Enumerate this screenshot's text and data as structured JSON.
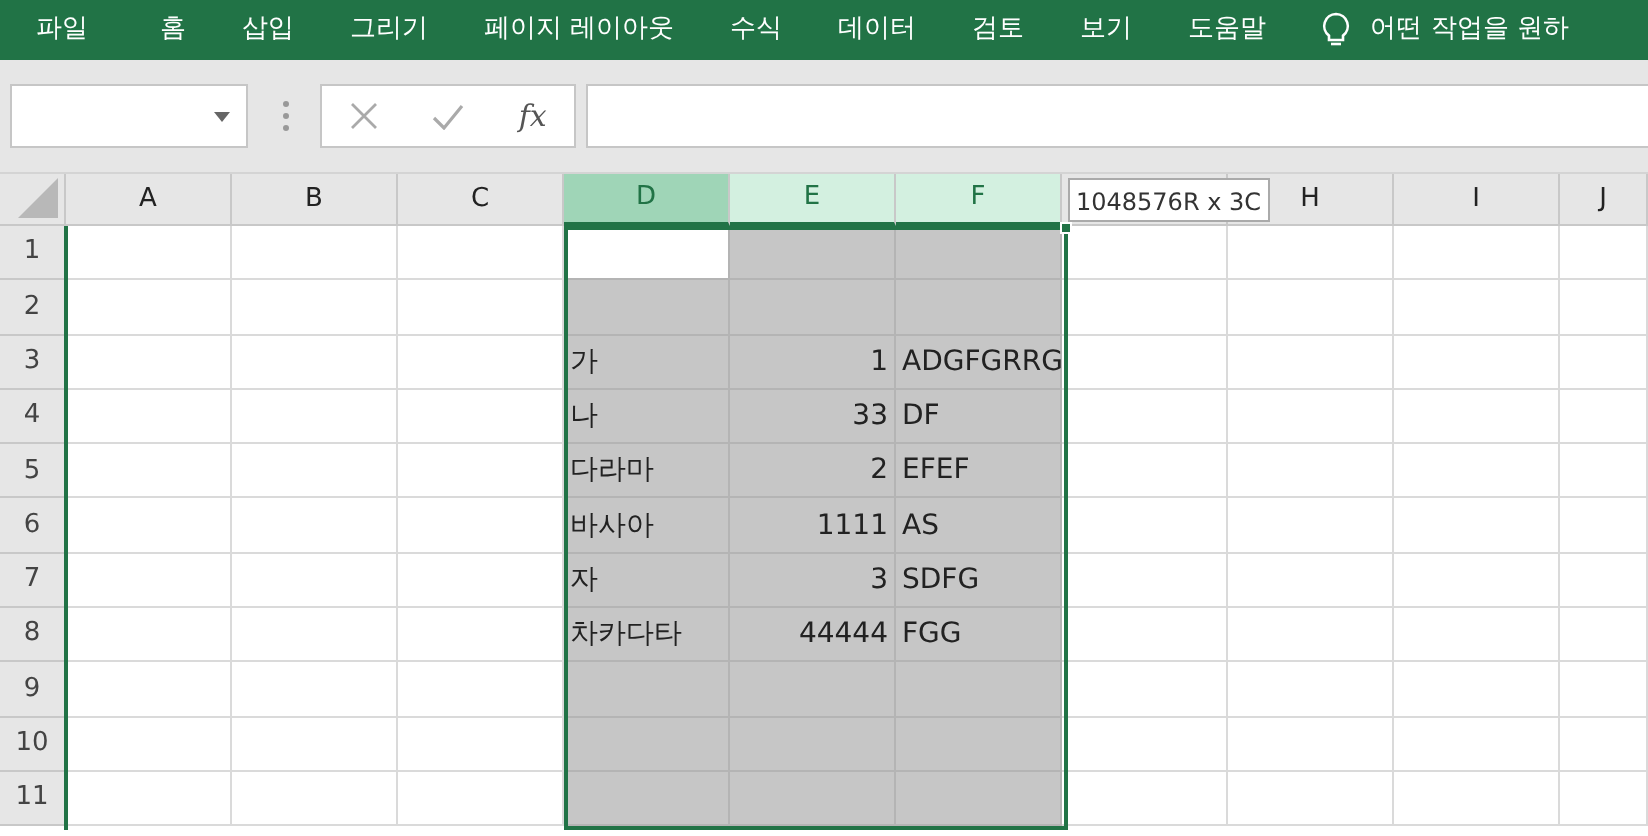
{
  "ribbon_tabs": [
    {
      "label": "파일"
    },
    {
      "label": "홈"
    },
    {
      "label": "삽입"
    },
    {
      "label": "그리기"
    },
    {
      "label": "페이지 레이아웃"
    },
    {
      "label": "수식"
    },
    {
      "label": "데이터"
    },
    {
      "label": "검토"
    },
    {
      "label": "보기"
    },
    {
      "label": "도움말"
    }
  ],
  "tell_me": {
    "text": "어떤 작업을 원하"
  },
  "formula_bar": {
    "fx": "fx"
  },
  "columns": [
    {
      "label": "A",
      "selected": false
    },
    {
      "label": "B",
      "selected": false
    },
    {
      "label": "C",
      "selected": false
    },
    {
      "label": "D",
      "selected": true
    },
    {
      "label": "E",
      "selected": true
    },
    {
      "label": "F",
      "selected": true
    },
    {
      "selected": false
    },
    {
      "label": "H",
      "selected": false
    },
    {
      "label": "I",
      "selected": false
    },
    {
      "label": "J",
      "selected": false
    }
  ],
  "selection_tooltip": "1048576R x 3C",
  "rows": [
    {
      "number": "1",
      "active": true
    },
    {
      "number": "2",
      "active": false
    },
    {
      "number": "3",
      "active": false,
      "cells": [
        "가",
        "1",
        "ADGFGRRG"
      ]
    },
    {
      "number": "4",
      "active": false,
      "cells": [
        "나",
        "33",
        "DF"
      ]
    },
    {
      "number": "5",
      "active": false,
      "cells": [
        "다라마",
        "2",
        "EFEF"
      ]
    },
    {
      "number": "6",
      "active": false,
      "cells": [
        "바사아",
        "1111",
        "AS"
      ]
    },
    {
      "number": "7",
      "active": false,
      "cells": [
        "자",
        "3",
        "SDFG"
      ]
    },
    {
      "number": "8",
      "active": false,
      "cells": [
        "차카다타",
        "44444",
        "FGG"
      ]
    },
    {
      "number": "9",
      "active": false
    },
    {
      "number": "10",
      "active": false
    },
    {
      "number": "11",
      "active": false
    }
  ]
}
